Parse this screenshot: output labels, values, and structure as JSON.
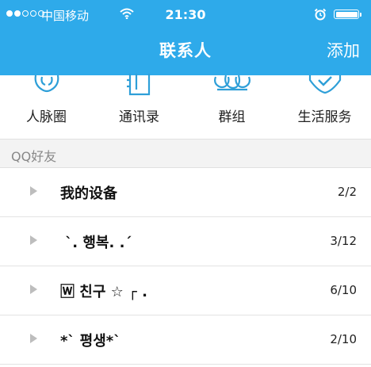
{
  "status_bar": {
    "carrier": "中国移动",
    "time": "21:30",
    "wifi_icon": "wifi-icon",
    "alarm_icon": "alarm-icon",
    "battery_icon": "battery-icon",
    "signal_bars_filled": 2,
    "signal_bars_total": 5
  },
  "nav": {
    "title": "联系人",
    "add_label": "添加"
  },
  "quick_entries": [
    {
      "label": "人脉圈",
      "icon": "network-circle-icon"
    },
    {
      "label": "通讯录",
      "icon": "address-book-icon"
    },
    {
      "label": "群组",
      "icon": "group-icon"
    },
    {
      "label": "生活服务",
      "icon": "life-service-icon"
    }
  ],
  "section": {
    "title": "QQ好友"
  },
  "groups": [
    {
      "name": "我的设备",
      "count": "2/2"
    },
    {
      "name": " `. 행복. .´",
      "count": "3/12"
    },
    {
      "name": "🅆 친구 ☆ ┌ .",
      "count": "6/10"
    },
    {
      "name": "*` 평생*`",
      "count": "2/10"
    }
  ],
  "colors": {
    "header_bg": "#2eaaea",
    "icon_blue": "#2e9fd8",
    "section_bg": "#f3f3f3"
  }
}
